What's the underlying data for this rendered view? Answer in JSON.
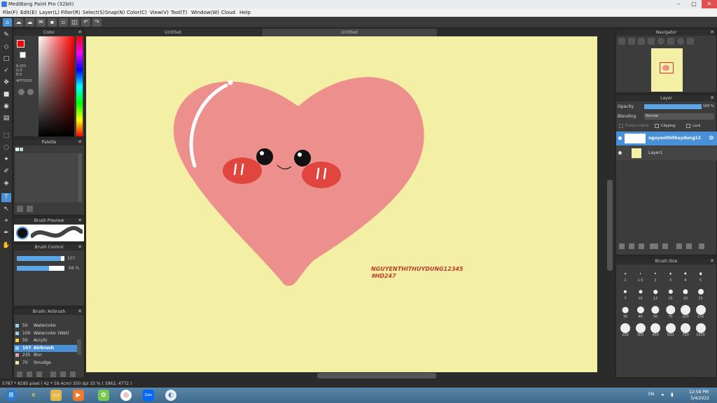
{
  "window": {
    "title": "MediBang Paint Pro (32bit)"
  },
  "menu": [
    "File(F)",
    "Edit(E)",
    "Layer(L)",
    "Filter(R)",
    "Select(S)",
    "Snap(N)",
    "Color(C)",
    "View(V)",
    "Tool(T)",
    "Window(W)",
    "Cloud",
    "Help"
  ],
  "tabs": [
    "Untitled",
    "Untitled"
  ],
  "panels": {
    "color": {
      "title": "Color",
      "r": "R:255",
      "g": "G:0",
      "b": "B:0",
      "hex": "#FF0000"
    },
    "palette": {
      "title": "Palette"
    },
    "brush_preview": {
      "title": "Brush Preview"
    },
    "brush_control": {
      "title": "Brush Control",
      "size": "107",
      "opacity": "68 %"
    },
    "brushes": {
      "title": "Brush: Airbrush",
      "items": [
        {
          "v": "50",
          "n": "Watercolor",
          "c": "#9ad0f5"
        },
        {
          "v": "100",
          "n": "Watercolor (Wet)",
          "c": "#9ad0f5"
        },
        {
          "v": "50",
          "n": "Acrylic",
          "c": "#f7d23c"
        },
        {
          "v": "107",
          "n": "Airbrush",
          "c": "#9ad0f5"
        },
        {
          "v": "235",
          "n": "Blur",
          "c": "#f49ac1"
        },
        {
          "v": "70",
          "n": "Smudge",
          "c": "#f3e29b"
        }
      ]
    },
    "navigator": {
      "title": "Navigator"
    },
    "layer": {
      "title": "Layer",
      "opacity_label": "Opacity",
      "opacity_value": "100 %",
      "blending_label": "Blending",
      "blending_value": "Normal",
      "protect_alpha": "Protect Alpha",
      "clipping": "Clipping",
      "lock": "Lock",
      "layers": [
        "nguyenthithuydung12",
        "Layer1"
      ]
    },
    "brush_size": {
      "title": "Brush Size",
      "sizes": [
        "1",
        "1.5",
        "2",
        "3",
        "4",
        "5",
        "7",
        "10",
        "12",
        "15",
        "20",
        "25",
        "30",
        "40",
        "50",
        "70",
        "100",
        "150",
        "200",
        "300",
        "400",
        "500",
        "700",
        "1000"
      ]
    }
  },
  "canvas": {
    "signature_line1": "NGUYENTHITHUYDUNG12345",
    "signature_line2": "#HD247",
    "bg": "#f3efa5",
    "heart": "#ec8f8d"
  },
  "status": {
    "text": "5787 * 8185 pixel  ( 42 * 59.4cm)  350 dpi  33 %  ( 3963, 4772 )"
  },
  "taskbar": {
    "lang": "EN",
    "time": "12:58 PM",
    "date": "3/4/2022"
  }
}
